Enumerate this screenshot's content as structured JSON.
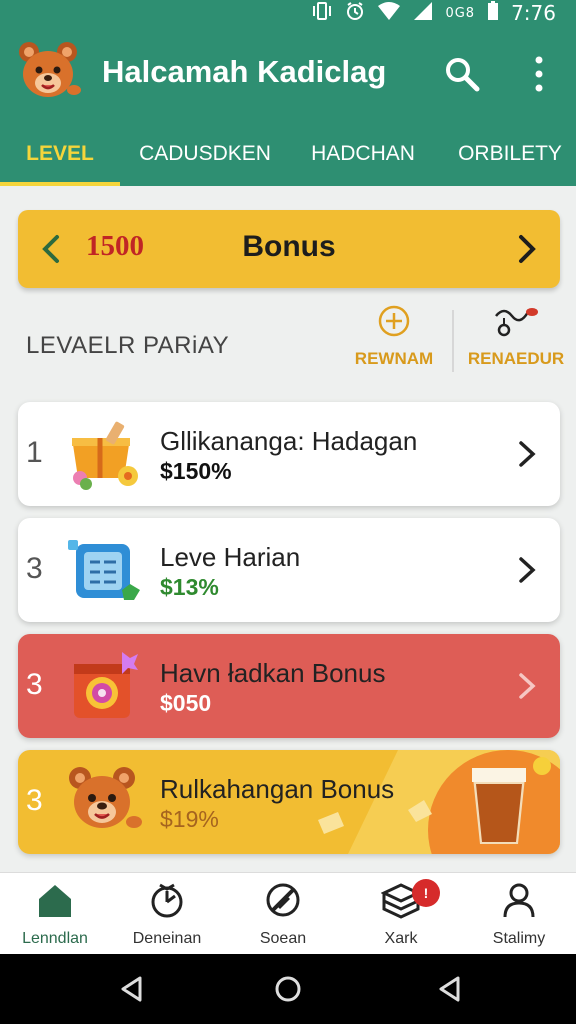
{
  "status_bar": {
    "network": "0G8",
    "time": "7:76"
  },
  "app_bar": {
    "title": "Halcamah Kadiclag",
    "logo": "bear-mascot-icon",
    "search_icon": "search-icon",
    "more_icon": "more-vert-icon"
  },
  "tabs": [
    {
      "label": "LEVEL",
      "active": true
    },
    {
      "label": "CADUSDKEN",
      "active": false
    },
    {
      "label": "HADCHAN",
      "active": false
    },
    {
      "label": "ORBILETY",
      "active": false
    }
  ],
  "bonus_bar": {
    "amount": "1500",
    "label": "Bonus",
    "background": "#f2bd32"
  },
  "section": {
    "title": "LEVAELR PARiAY",
    "actions": [
      {
        "label": "REWNAM",
        "icon": "plus-circle-icon"
      },
      {
        "label": "RENAEDUR",
        "icon": "pulley-icon"
      }
    ]
  },
  "cards": [
    {
      "number": "1",
      "title": "Gllikananga: Hadagan",
      "value": "$150%",
      "icon": "gift-box-icon",
      "background": "#ffffff",
      "value_color": "#111111"
    },
    {
      "number": "3",
      "title": "Leve Harian",
      "value": "$13%",
      "icon": "calculator-icon",
      "background": "#ffffff",
      "value_color": "#2f8a2f"
    },
    {
      "number": "3",
      "title": "Havn ładkan Bonus",
      "value": "$050",
      "icon": "camera-icon",
      "background": "#de5d56",
      "value_color": "#ffffff"
    },
    {
      "number": "3",
      "title": "Rulkahangan Bonus",
      "value": "$19%",
      "icon": "bear-mascot-icon",
      "background": "#f2bd32",
      "value_color": "#a5641f"
    }
  ],
  "bottom_nav": [
    {
      "label": "Lenndlan",
      "icon": "home-icon",
      "active": true
    },
    {
      "label": "Deneinan",
      "icon": "timer-icon",
      "active": false
    },
    {
      "label": "Soean",
      "icon": "no-pen-icon",
      "active": false
    },
    {
      "label": "Xark",
      "icon": "box-icon",
      "active": false,
      "badge": "!"
    },
    {
      "label": "Stalimy",
      "icon": "person-icon",
      "active": false
    }
  ],
  "system_nav": [
    "back-icon",
    "home-circle-icon",
    "recent-icon"
  ]
}
